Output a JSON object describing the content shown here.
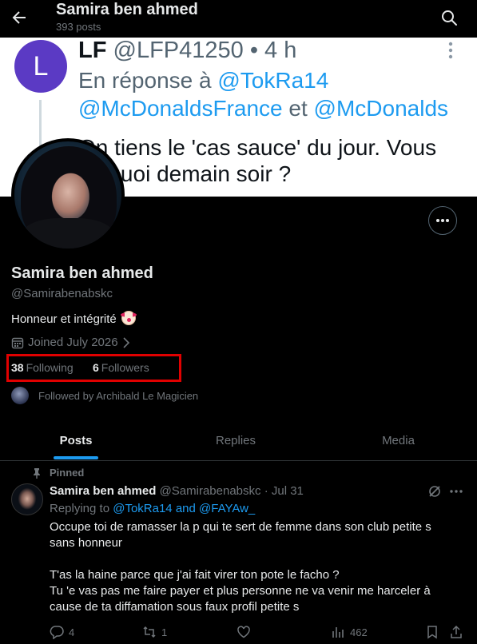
{
  "header": {
    "title": "Samira ben ahmed",
    "posts_count": "393 posts"
  },
  "banner": {
    "avatar_letter": "L",
    "author_name": "LF",
    "author_meta": "@LFP41250 • 4 h",
    "reply_prefix": "En réponse à",
    "reply_mention1": "@TokRa14",
    "reply_mention2": "@McDonaldsFrance",
    "reply_and": "et",
    "reply_mention3": "@McDonalds",
    "quote_line1": "On tiens le 'cas sauce' du jour. Vous",
    "quote_line2": "es quoi demain soir ?"
  },
  "profile": {
    "name": "Samira ben ahmed",
    "handle": "@Samirabenabskc",
    "bio": "Honneur et intégrité",
    "joined": "Joined July 2026",
    "following_count": "38",
    "following_label": "Following",
    "followers_count": "6",
    "followers_label": "Followers",
    "followed_by": "Followed by Archibald Le Magicien",
    "highlight_color": "#e00000"
  },
  "tabs": [
    {
      "label": "Posts",
      "active": true
    },
    {
      "label": "Replies",
      "active": false
    },
    {
      "label": "Media",
      "active": false
    }
  ],
  "post": {
    "pinned_label": "Pinned",
    "author_name": "Samira ben ahmed",
    "author_handle": "@Samirabenabskc",
    "date": "· Jul 31",
    "replying_prefix": "Replying to",
    "replying_to": "@TokRa14 and @FAYAw_",
    "text_line1": "Occupe toi de ramasser la p qui te sert de femme dans son club petite s",
    "text_line2": "sans honneur",
    "text_line3": "T'as la haine parce que j'ai fait virer ton pote le facho ?",
    "text_line4": "Tu 'e vas pas me faire payer et plus personne ne va venir me harceler à",
    "text_line5": "cause de ta diffamation sous faux profil petite s",
    "replies": "4",
    "reposts": "1",
    "views": "462"
  },
  "colors": {
    "accent": "#1d9bf0",
    "background": "#000000",
    "muted": "#71767b"
  }
}
